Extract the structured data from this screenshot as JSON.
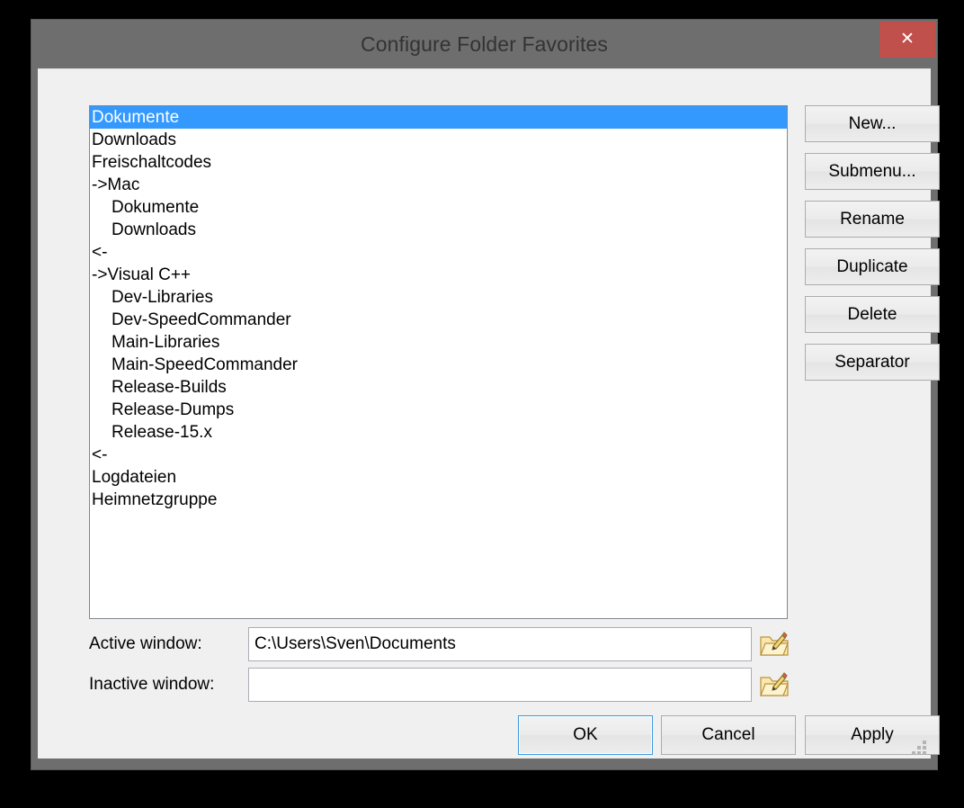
{
  "window": {
    "title": "Configure Folder Favorites",
    "close_label": "✕",
    "chrome_color": "#6e6e6e",
    "accent_color": "#3399ff",
    "close_color": "#c0504c"
  },
  "favorites": {
    "items": [
      {
        "label": "Dokumente",
        "indent": false,
        "selected": true
      },
      {
        "label": "Downloads",
        "indent": false,
        "selected": false
      },
      {
        "label": "Freischaltcodes",
        "indent": false,
        "selected": false
      },
      {
        "label": "->Mac",
        "indent": false,
        "selected": false
      },
      {
        "label": "Dokumente",
        "indent": true,
        "selected": false
      },
      {
        "label": "Downloads",
        "indent": true,
        "selected": false
      },
      {
        "label": "<-",
        "indent": false,
        "selected": false
      },
      {
        "label": "->Visual C++",
        "indent": false,
        "selected": false
      },
      {
        "label": "Dev-Libraries",
        "indent": true,
        "selected": false
      },
      {
        "label": "Dev-SpeedCommander",
        "indent": true,
        "selected": false
      },
      {
        "label": "Main-Libraries",
        "indent": true,
        "selected": false
      },
      {
        "label": "Main-SpeedCommander",
        "indent": true,
        "selected": false
      },
      {
        "label": "Release-Builds",
        "indent": true,
        "selected": false
      },
      {
        "label": "Release-Dumps",
        "indent": true,
        "selected": false
      },
      {
        "label": "Release-15.x",
        "indent": true,
        "selected": false
      },
      {
        "label": "<-",
        "indent": false,
        "selected": false
      },
      {
        "label": "Logdateien",
        "indent": false,
        "selected": false
      },
      {
        "label": "Heimnetzgruppe",
        "indent": false,
        "selected": false
      }
    ]
  },
  "side_buttons": [
    {
      "label": "New...",
      "name": "new-button"
    },
    {
      "label": "Submenu...",
      "name": "submenu-button"
    },
    {
      "label": "Rename",
      "name": "rename-button"
    },
    {
      "label": "Duplicate",
      "name": "duplicate-button"
    },
    {
      "label": "Delete",
      "name": "delete-button"
    },
    {
      "label": "Separator",
      "name": "separator-button"
    }
  ],
  "fields": {
    "active": {
      "label": "Active window:",
      "value": "C:\\Users\\Sven\\Documents",
      "placeholder": ""
    },
    "inactive": {
      "label": "Inactive window:",
      "value": "",
      "placeholder": ""
    }
  },
  "dialog_buttons": {
    "ok": "OK",
    "cancel": "Cancel",
    "apply": "Apply"
  }
}
